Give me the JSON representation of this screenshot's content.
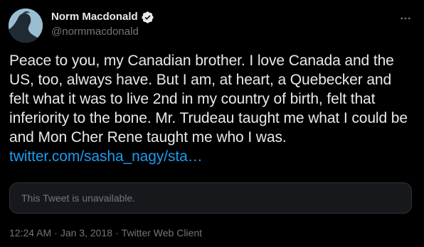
{
  "author": {
    "display_name": "Norm Macdonald",
    "handle": "@normmacdonald",
    "avatar_icon": "profile-silhouette-avatar",
    "verified_icon": "verified-badge-icon",
    "accent": "#1d9bf0"
  },
  "tweet": {
    "text": "Peace to you, my Canadian brother. I love Canada and the US, too, always have. But I am, at heart, a Quebecker and felt what it was to live 2nd in my country of birth, felt that inferiority to the bone. Mr. Trudeau taught me what I could be and Mon Cher Rene taught me who I was. ",
    "link_text": "twitter.com/sasha_nagy/sta…",
    "quoted_notice": "This Tweet is unavailable."
  },
  "meta": {
    "time": "12:24 AM",
    "separator_1": "·",
    "date": "Jan 3, 2018",
    "separator_2": "·",
    "source": "Twitter Web Client"
  },
  "actions": {
    "more_icon": "more-options-icon"
  }
}
